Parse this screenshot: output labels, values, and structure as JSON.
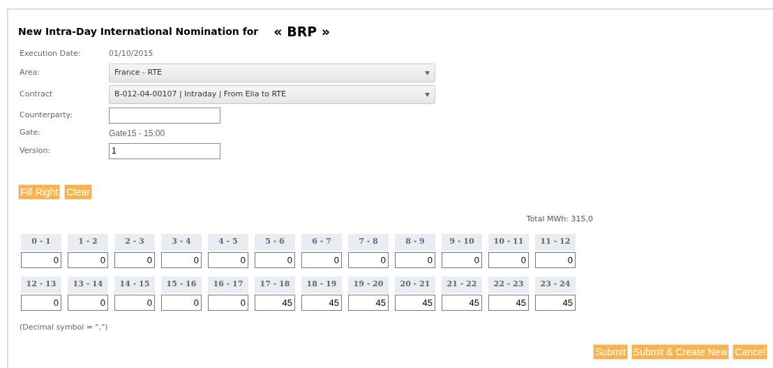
{
  "title": "New Intra-Day International Nomination for",
  "subject": "« BRP »",
  "fields": [
    {
      "kind": "text",
      "label": "Execution Date:",
      "value": "01/10/2015"
    },
    {
      "kind": "select",
      "label": "Area:",
      "value": "France - RTE"
    },
    {
      "kind": "select",
      "label": "Contract",
      "value": "B-012-04-00107 | Intraday | From Elia to RTE"
    },
    {
      "kind": "input",
      "label": "Counterparty:"
    },
    {
      "kind": "plain",
      "label": "Gate:",
      "value": "Gate15 - 15:00"
    },
    {
      "kind": "input",
      "label": "Version:",
      "value": "1"
    }
  ],
  "tools": [
    "Fill Right",
    "Clear"
  ],
  "total": "Total MWh: 315,0",
  "hours": [
    {
      "label": "0 - 1",
      "value": "0"
    },
    {
      "label": "1 - 2",
      "value": "0"
    },
    {
      "label": "2 - 3",
      "value": "0"
    },
    {
      "label": "3 - 4",
      "value": "0"
    },
    {
      "label": "4 - 5",
      "value": "0"
    },
    {
      "label": "5 - 6",
      "value": "0"
    },
    {
      "label": "6 - 7",
      "value": "0"
    },
    {
      "label": "7 - 8",
      "value": "0"
    },
    {
      "label": "8 - 9",
      "value": "0"
    },
    {
      "label": "9 - 10",
      "value": "0"
    },
    {
      "label": "10 - 11",
      "value": "0"
    },
    {
      "label": "11 - 12",
      "value": "0"
    },
    {
      "label": "12 - 13",
      "value": "0"
    },
    {
      "label": "13 - 14",
      "value": "0"
    },
    {
      "label": "14 - 15",
      "value": "0"
    },
    {
      "label": "15 - 16",
      "value": "0"
    },
    {
      "label": "16 - 17",
      "value": "0"
    },
    {
      "label": "17 - 18",
      "value": "45"
    },
    {
      "label": "18 - 19",
      "value": "45"
    },
    {
      "label": "19 - 20",
      "value": "45"
    },
    {
      "label": "20 - 21",
      "value": "45"
    },
    {
      "label": "21 - 22",
      "value": "45"
    },
    {
      "label": "22 - 23",
      "value": "45"
    },
    {
      "label": "23 - 24",
      "value": "45"
    }
  ],
  "note": "(Decimal symbol = \",\")",
  "actions": [
    "Submit",
    "Submit & Create New",
    "Cancel"
  ]
}
